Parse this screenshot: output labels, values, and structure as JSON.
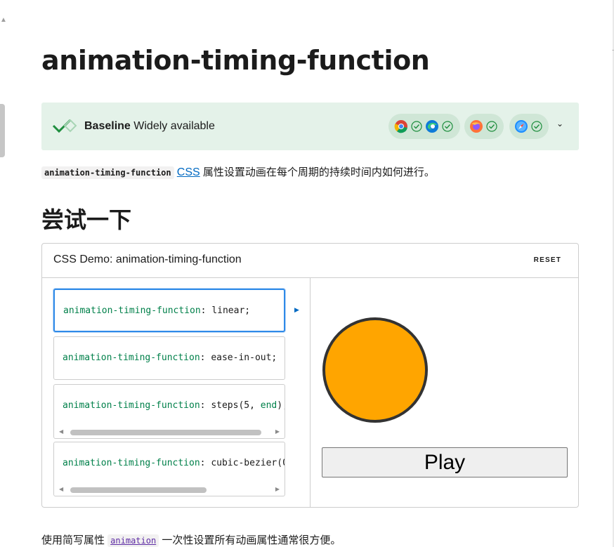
{
  "page": {
    "title": "animation-timing-function"
  },
  "baseline": {
    "label_bold": "Baseline",
    "label_rest": " Widely available",
    "browsers": [
      {
        "name": "chrome-icon",
        "color": "#4285f4"
      },
      {
        "name": "edge-icon",
        "color": "#0f7bd8"
      },
      {
        "name": "firefox-icon",
        "color": "#ff7139"
      },
      {
        "name": "safari-icon",
        "color": "#1a8cff"
      }
    ],
    "accent": "#e4f2e9"
  },
  "intro": {
    "code": "animation-timing-function",
    "link": "CSS",
    "text": " 属性设置动画在每个周期的持续时间内如何进行。"
  },
  "try_heading": "尝试一下",
  "demo": {
    "title": "CSS Demo: animation-timing-function",
    "reset_label": "RESET",
    "choices": [
      {
        "prop": "animation-timing-function",
        "sep": ": ",
        "value": "linear;"
      },
      {
        "prop": "animation-timing-function",
        "sep": ": ",
        "value": "ease-in-out;"
      },
      {
        "prop": "animation-timing-function",
        "sep": ": ",
        "value": "steps(5, ",
        "kw": "end",
        "tail": ");"
      },
      {
        "prop": "animation-timing-function",
        "sep": ": ",
        "value": "cubic-bezier(0"
      }
    ],
    "play_label": "Play",
    "ball_color": "#ffa500"
  },
  "footer": {
    "before": "使用简写属性 ",
    "code": "animation",
    "after": " 一次性设置所有动画属性通常很方便。"
  }
}
